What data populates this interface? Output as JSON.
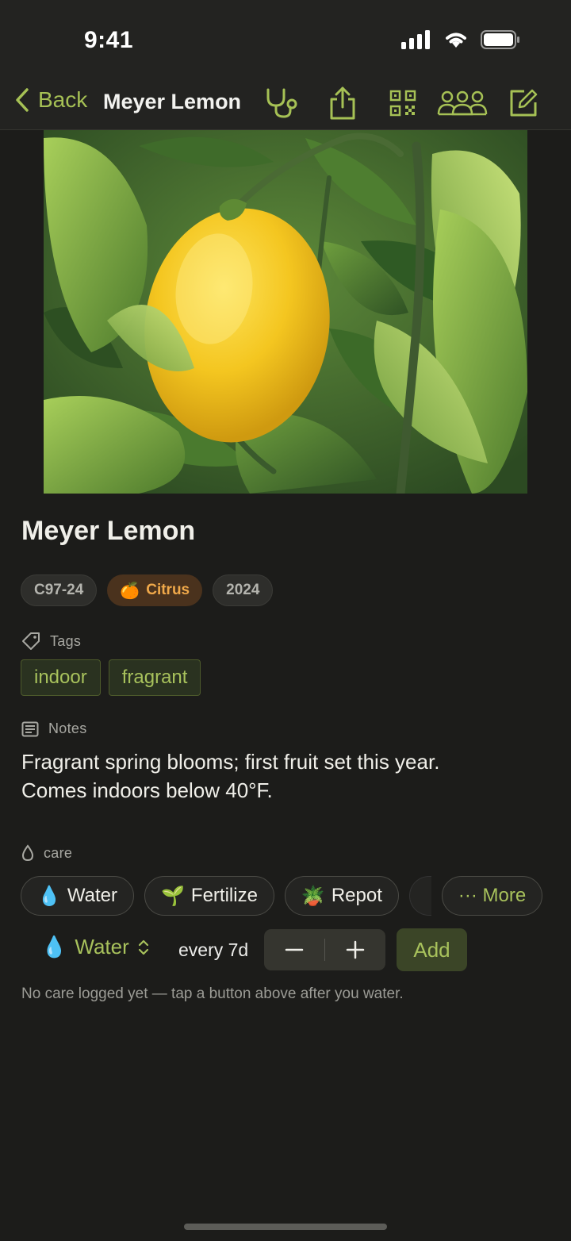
{
  "status_bar": {
    "time": "9:41"
  },
  "nav": {
    "back_label": "Back",
    "title": "Meyer Lemon",
    "icons": [
      "stethoscope-icon",
      "share-icon",
      "qr-code-icon",
      "people-icon",
      "edit-icon"
    ]
  },
  "plant": {
    "name": "Meyer Lemon",
    "chips": [
      {
        "label": "C97-24"
      },
      {
        "label": "Citrus",
        "emoji": "🍊"
      },
      {
        "label": "2024"
      }
    ]
  },
  "tags": {
    "label": "Tags",
    "items": [
      "indoor",
      "fragrant"
    ]
  },
  "notes": {
    "label": "Notes",
    "line1": "Fragrant spring blooms; first fruit set this year.",
    "line2": "Comes indoors below 40°F."
  },
  "care": {
    "label": "care",
    "buttons": [
      {
        "label": "Water",
        "emoji": "💧"
      },
      {
        "label": "Fertilize",
        "emoji": "🌱"
      },
      {
        "label": "Repot",
        "emoji": "🪴"
      }
    ],
    "more_label": "··· More",
    "schedule": {
      "type": "Water",
      "emoji": "💧",
      "interval": "every 7d",
      "add_label": "Add"
    },
    "empty_message": "No care logged yet — tap a button above after you water."
  },
  "colors": {
    "accent": "#a8c25c",
    "background": "#1c1c1a",
    "citrus": "#f0a94a"
  }
}
